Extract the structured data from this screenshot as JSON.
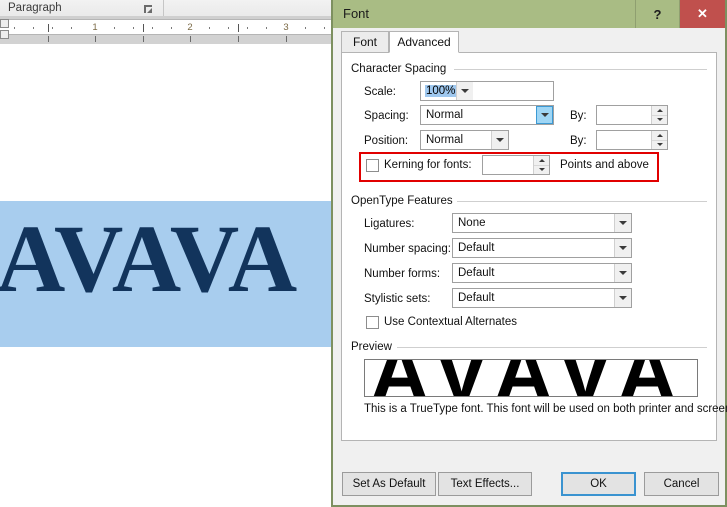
{
  "word": {
    "ribbon_group_label": "Paragraph",
    "dialog_launcher_name": "dialog-launcher-icon",
    "ruler_numbers": [
      "1",
      "2",
      "3"
    ],
    "document_text": "AVAVA",
    "selection_color": "#a8cdee",
    "text_color": "#12345c"
  },
  "dialog": {
    "title": "Font",
    "help_label": "?",
    "close_label": "✕",
    "titlebar_color": "#a9bc84",
    "close_color": "#c0504d",
    "tabs": [
      {
        "label": "Font",
        "active": false
      },
      {
        "label": "Advanced",
        "active": true
      }
    ],
    "character_spacing": {
      "group_label": "Character Spacing",
      "scale": {
        "label": "Scale:",
        "value": "100%",
        "selected": true
      },
      "spacing": {
        "label": "Spacing:",
        "value": "Normal",
        "arrow_hover": true,
        "by_label": "By:",
        "by_value": ""
      },
      "position": {
        "label": "Position:",
        "value": "Normal",
        "by_label": "By:",
        "by_value": ""
      },
      "kerning": {
        "label": "Kerning for fonts:",
        "checked": false,
        "value": "",
        "suffix": "Points and above",
        "annotated": true,
        "annotation_color": "#e10000"
      }
    },
    "opentype": {
      "group_label": "OpenType Features",
      "rows": [
        {
          "label": "Ligatures:",
          "value": "None"
        },
        {
          "label": "Number spacing:",
          "value": "Default"
        },
        {
          "label": "Number forms:",
          "value": "Default"
        },
        {
          "label": "Stylistic sets:",
          "value": "Default"
        }
      ],
      "contextual_alternates": {
        "label": "Use Contextual Alternates",
        "checked": false
      }
    },
    "preview": {
      "group_label": "Preview",
      "sample_text": "AVAVA",
      "note": "This is a TrueType font. This font will be used on both printer and screen."
    },
    "buttons": [
      {
        "label": "Set As Default",
        "primary": false
      },
      {
        "label": "Text Effects...",
        "primary": false
      },
      {
        "label": "OK",
        "primary": true
      },
      {
        "label": "Cancel",
        "primary": false
      }
    ]
  }
}
